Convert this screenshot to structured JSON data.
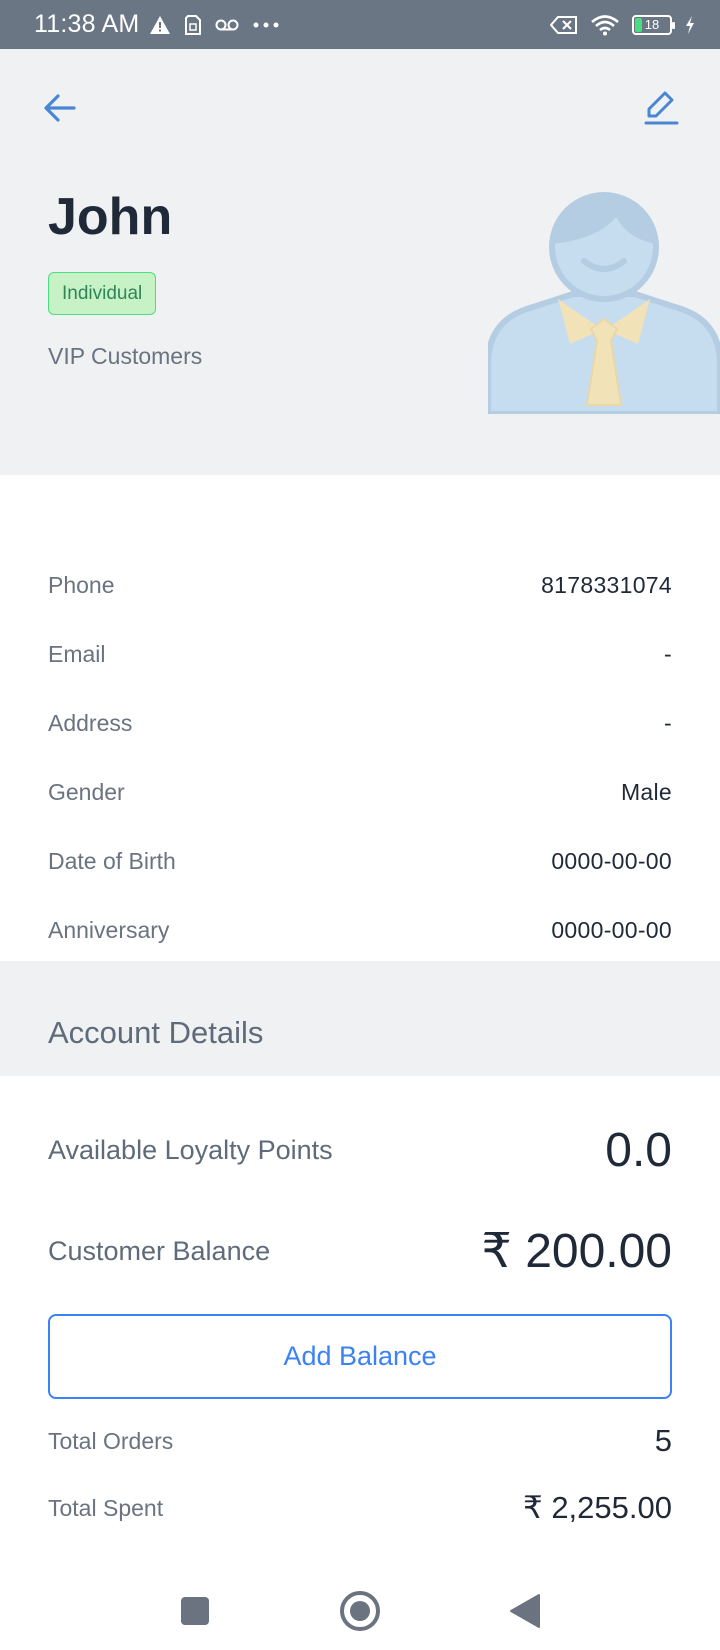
{
  "status_bar": {
    "time": "11:38 AM",
    "battery_level": "18",
    "icons": [
      "warning-icon",
      "sim-icon",
      "voicemail-icon",
      "more-dots-icon",
      "no-sim-icon",
      "wifi-icon",
      "battery-icon",
      "charging-icon"
    ]
  },
  "header": {
    "customer_name": "John",
    "customer_type": "Individual",
    "customer_group": "VIP Customers",
    "colors": {
      "background": "#f0f1f3",
      "accent": "#3b82f6",
      "badge_bg": "#c6f2c5",
      "badge_border": "#4ade80"
    }
  },
  "details": [
    {
      "label": "Phone",
      "value": "8178331074"
    },
    {
      "label": "Email",
      "value": "-"
    },
    {
      "label": "Address",
      "value": "-"
    },
    {
      "label": "Gender",
      "value": "Male"
    },
    {
      "label": "Date of Birth",
      "value": "0000-00-00"
    },
    {
      "label": "Anniversary",
      "value": "0000-00-00"
    }
  ],
  "account": {
    "title": "Account Details",
    "loyalty_label": "Available Loyalty Points",
    "loyalty_value": "0.0",
    "balance_label": "Customer Balance",
    "balance_value": "₹ 200.00",
    "add_balance_label": "Add Balance",
    "total_orders_label": "Total Orders",
    "total_orders_value": "5",
    "total_spent_label": "Total Spent",
    "total_spent_value": "₹ 2,255.00"
  }
}
